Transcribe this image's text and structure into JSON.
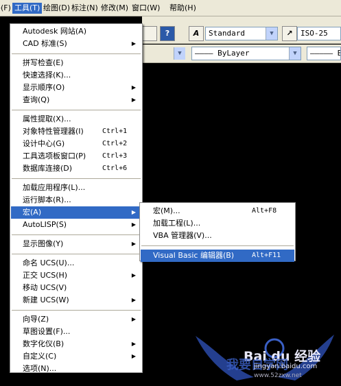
{
  "menubar": [
    {
      "label": "文件(F)",
      "active": false
    },
    {
      "label": "工具(T)",
      "active": true
    },
    {
      "label": "绘图(D)",
      "active": false
    },
    {
      "label": "标注(N)",
      "active": false
    },
    {
      "label": "修改(M)",
      "active": false
    },
    {
      "label": "窗口(W)",
      "active": false
    },
    {
      "label": "帮助(H)",
      "active": false
    }
  ],
  "toolbar": {
    "text_style": "Standard",
    "dim_style": "ISO-25",
    "layer_linetype": "———— ByLayer",
    "layer_linetype2": "————— B",
    "style_icon_label": "A",
    "dim_icon_label": "↗"
  },
  "tools_menu": {
    "items": [
      {
        "label": "Autodesk 网站(A)",
        "shortcut": "",
        "submenu": false,
        "sep_after": false
      },
      {
        "label": "CAD 标准(S)",
        "shortcut": "",
        "submenu": true,
        "sep_after": true
      },
      {
        "label": "拼写检查(E)",
        "shortcut": "",
        "submenu": false,
        "sep_after": false
      },
      {
        "label": "快速选择(K)...",
        "shortcut": "",
        "submenu": false,
        "sep_after": false
      },
      {
        "label": "显示顺序(O)",
        "shortcut": "",
        "submenu": true,
        "sep_after": false
      },
      {
        "label": "查询(Q)",
        "shortcut": "",
        "submenu": true,
        "sep_after": true
      },
      {
        "label": "属性提取(X)...",
        "shortcut": "",
        "submenu": false,
        "sep_after": false
      },
      {
        "label": "对象特性管理器(I)",
        "shortcut": "Ctrl+1",
        "submenu": false,
        "sep_after": false
      },
      {
        "label": "设计中心(G)",
        "shortcut": "Ctrl+2",
        "submenu": false,
        "sep_after": false
      },
      {
        "label": "工具选项板窗口(P)",
        "shortcut": "Ctrl+3",
        "submenu": false,
        "sep_after": false
      },
      {
        "label": "数据库连接(D)",
        "shortcut": "Ctrl+6",
        "submenu": false,
        "sep_after": true
      },
      {
        "label": "加载应用程序(L)...",
        "shortcut": "",
        "submenu": false,
        "sep_after": false
      },
      {
        "label": "运行脚本(R)...",
        "shortcut": "",
        "submenu": false,
        "sep_after": false
      },
      {
        "label": "宏(A)",
        "shortcut": "",
        "submenu": true,
        "sep_after": false,
        "highlight": true
      },
      {
        "label": "AutoLISP(S)",
        "shortcut": "",
        "submenu": true,
        "sep_after": true
      },
      {
        "label": "显示图像(Y)",
        "shortcut": "",
        "submenu": true,
        "sep_after": true
      },
      {
        "label": "命名 UCS(U)...",
        "shortcut": "",
        "submenu": false,
        "sep_after": false
      },
      {
        "label": "正交 UCS(H)",
        "shortcut": "",
        "submenu": true,
        "sep_after": false
      },
      {
        "label": "移动 UCS(V)",
        "shortcut": "",
        "submenu": false,
        "sep_after": false
      },
      {
        "label": "新建 UCS(W)",
        "shortcut": "",
        "submenu": true,
        "sep_after": true
      },
      {
        "label": "向导(Z)",
        "shortcut": "",
        "submenu": true,
        "sep_after": false
      },
      {
        "label": "草图设置(F)...",
        "shortcut": "",
        "submenu": false,
        "sep_after": false
      },
      {
        "label": "数字化仪(B)",
        "shortcut": "",
        "submenu": true,
        "sep_after": false
      },
      {
        "label": "自定义(C)",
        "shortcut": "",
        "submenu": true,
        "sep_after": false
      },
      {
        "label": "选项(N)...",
        "shortcut": "",
        "submenu": false,
        "sep_after": false
      }
    ]
  },
  "macro_submenu": {
    "items": [
      {
        "label": "宏(M)...",
        "shortcut": "Alt+F8",
        "sep_after": false
      },
      {
        "label": "加载工程(L)...",
        "shortcut": "",
        "sep_after": false
      },
      {
        "label": "VBA 管理器(V)...",
        "shortcut": "",
        "sep_after": true
      },
      {
        "label": "Visual Basic 编辑器(B)",
        "shortcut": "Alt+F11",
        "sep_after": false,
        "highlight": true
      }
    ]
  },
  "watermark": {
    "brand": "Bai du 经验",
    "cn": "我要自学网",
    "url1": "jingyan.baidu.com",
    "url2": "www.52zxw.net"
  }
}
